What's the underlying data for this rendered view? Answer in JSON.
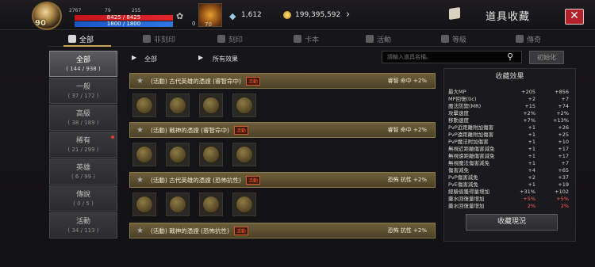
{
  "player": {
    "level": "90",
    "stat1": "2767",
    "stat2": "79",
    "stat3": "255",
    "hp": "8425 / 8425",
    "mp": "1800 / 1800",
    "potion_count": "0",
    "flask_count": "70"
  },
  "currency": {
    "diamonds": "1,612",
    "gold": "199,395,592"
  },
  "window": {
    "title": "道具收藏",
    "close": "✕"
  },
  "tabs": [
    {
      "label": "全部",
      "active": true
    },
    {
      "label": "非刻印"
    },
    {
      "label": "刻印"
    },
    {
      "label": "卡本"
    },
    {
      "label": "活動"
    },
    {
      "label": "等級"
    },
    {
      "label": "傳奇"
    }
  ],
  "categories": [
    {
      "name": "全部",
      "count": "( 144 / 938 )",
      "active": true
    },
    {
      "name": "一般",
      "count": "( 37 / 172 )"
    },
    {
      "name": "高級",
      "count": "( 38 / 189 )"
    },
    {
      "name": "稀有",
      "count": "( 21 / 299 )"
    },
    {
      "name": "英雄",
      "count": "( 6 / 99 )"
    },
    {
      "name": "傳說",
      "count": "( 0 / 5 )"
    },
    {
      "name": "活動",
      "count": "( 34 / 113 )"
    }
  ],
  "filters": {
    "filter1": "全部",
    "filter2": "所有效果"
  },
  "search": {
    "placeholder": "請輸入道具名稱。",
    "reset": "初始化"
  },
  "groups": [
    {
      "name": "(活動) 古代英雄的憑證 (睿智命中)",
      "badge": "活動",
      "effect": "睿智 命中 +2%"
    },
    {
      "name": "(活動) 戰神的憑證 (睿智命中)",
      "badge": "活動",
      "effect": "睿智 命中 +2%"
    },
    {
      "name": "(活動) 古代英雄的憑證 (恐怖抗性)",
      "badge": "活動",
      "effect": "恐怖 抗性 +2%"
    },
    {
      "name": "(活動) 戰神的憑證 (恐怖抗性)",
      "badge": "活動",
      "effect": "恐怖 抗性 +2%"
    }
  ],
  "effects_panel": {
    "title": "收藏效果",
    "rows": [
      {
        "name": "最大MP",
        "v1": "+205",
        "v2": "+856"
      },
      {
        "name": "MP回復(tic)",
        "v1": "+2",
        "v2": "+7"
      },
      {
        "name": "魔法防禦(MR)",
        "v1": "+15",
        "v2": "+74"
      },
      {
        "name": "攻擊速度",
        "v1": "+2%",
        "v2": "+2%"
      },
      {
        "name": "移動速度",
        "v1": "+7%",
        "v2": "+13%"
      },
      {
        "name": "PvP近距離附加傷害",
        "v1": "+1",
        "v2": "+26"
      },
      {
        "name": "PvP遠距離附加傷害",
        "v1": "+1",
        "v2": "+25"
      },
      {
        "name": "PvP魔法附加傷害",
        "v1": "+1",
        "v2": "+10"
      },
      {
        "name": "無視近距離傷害減免",
        "v1": "+1",
        "v2": "+17"
      },
      {
        "name": "無視遠距離傷害減免",
        "v1": "+1",
        "v2": "+17"
      },
      {
        "name": "無視魔法傷害減免",
        "v1": "+1",
        "v2": "+7"
      },
      {
        "name": "傷害減免",
        "v1": "+4",
        "v2": "+65"
      },
      {
        "name": "PvP傷害減免",
        "v1": "+2",
        "v2": "+37"
      },
      {
        "name": "PvE傷害減免",
        "v1": "+1",
        "v2": "+19"
      },
      {
        "name": "經驗值獲得量增加",
        "v1": "+31%",
        "v2": "+102"
      },
      {
        "name": "藥水回復量增加",
        "v1": "+5%",
        "v2": "+5%",
        "red": true
      },
      {
        "name": "藥水回復量增加",
        "v1": "2%",
        "v2": "2%",
        "red": true
      }
    ],
    "status_button": "收藏現況"
  }
}
